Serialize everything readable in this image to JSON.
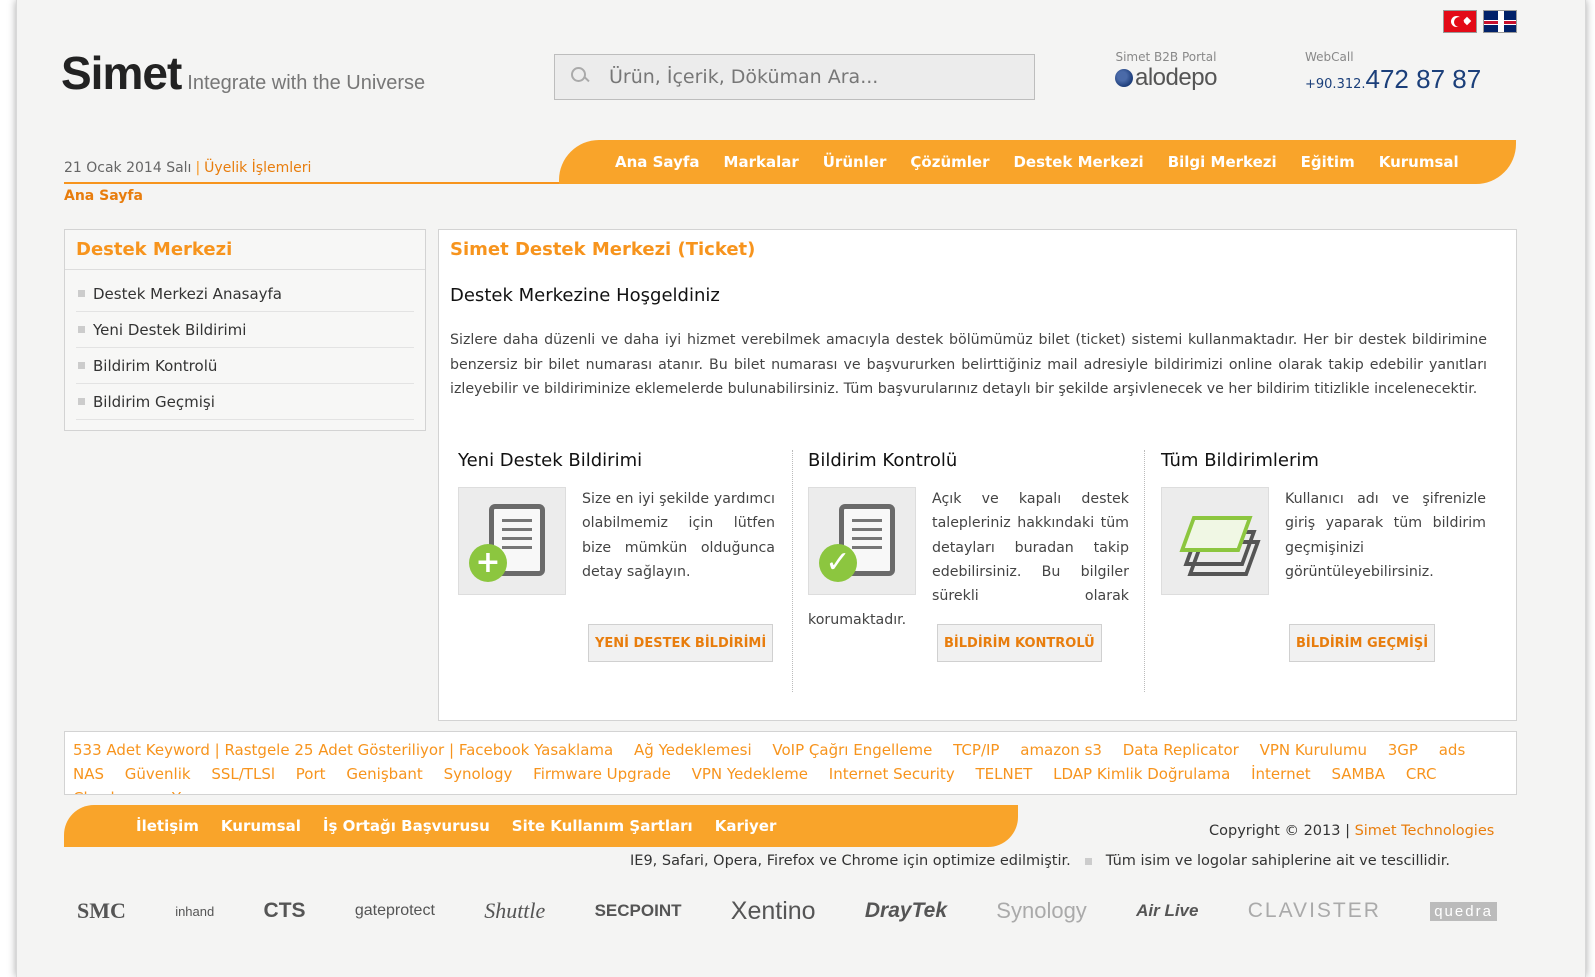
{
  "header": {
    "logo_text": "Simet",
    "tagline": "Integrate with the Universe",
    "search_placeholder": "Ürün, İçerik, Döküman Ara...",
    "portal_caption": "Simet B2B Portal",
    "portal_logo": "alodepo",
    "webcall_caption": "WebCall",
    "webcall_prefix": "+90.312.",
    "webcall_number": "472 87 87"
  },
  "meta": {
    "date": "21 Ocak 2014 Salı",
    "separator": "|",
    "membership_link": "Üyelik İşlemleri",
    "breadcrumb": "Ana Sayfa"
  },
  "nav": {
    "items": [
      "Ana Sayfa",
      "Markalar",
      "Ürünler",
      "Çözümler",
      "Destek Merkezi",
      "Bilgi Merkezi",
      "Eğitim",
      "Kurumsal"
    ]
  },
  "sidebar": {
    "title": "Destek Merkezi",
    "items": [
      "Destek Merkezi Anasayfa",
      "Yeni Destek Bildirimi",
      "Bildirim Kontrolü",
      "Bildirim Geçmişi"
    ]
  },
  "main": {
    "title": "Simet Destek Merkezi (Ticket)",
    "heading": "Destek Merkezine Hoşgeldiniz",
    "paragraph": "Sizlere daha düzenli ve daha iyi hizmet verebilmek amacıyla destek bölümümüz bilet (ticket) sistemi kullanmaktadır. Her bir destek bildirimine benzersiz bir bilet numarası atanır. Bu bilet numarası ve başvururken belirttiğiniz mail adresiyle bildirimizi online olarak takip edebilir yanıtları izleyebilir ve bildiriminize eklemelerde bulunabilirsiniz. Tüm başvurularınız detaylı bir şekilde arşivlenecek ve her bildirim titizlikle incelenecektir.",
    "columns": [
      {
        "heading": "Yeni Destek Bildirimi",
        "text": "Size en iyi şekilde yardımcı olabilmemiz için lütfen bize mümkün olduğunca detay sağlayın.",
        "button": "YENİ DESTEK BİLDİRİMİ",
        "icon": "new-ticket-icon",
        "badge": "+"
      },
      {
        "heading": "Bildirim Kontrolü",
        "text": "Açık ve kapalı destek talepleriniz hakkındaki tüm detayları buradan takip edebilirsiniz. Bu bilgiler sürekli olarak korumaktadır.",
        "button": "BİLDİRİM KONTROLÜ",
        "icon": "check-ticket-icon",
        "badge": "✓"
      },
      {
        "heading": "Tüm Bildirimlerim",
        "text": "Kullanıcı adı ve şifrenizle giriş yaparak tüm bildirim geçmişinizi görüntüleyebilirsiniz.",
        "button": "BİLDİRİM GEÇMİŞİ",
        "icon": "layers-icon"
      }
    ]
  },
  "tags": {
    "lead": "533 Adet Keyword | Rastgele 25 Adet Gösteriliyor |",
    "items": [
      "Facebook Yasaklama",
      "Ağ Yedeklemesi",
      "VoIP Çağrı Engelleme",
      "TCP/IP",
      "amazon s3",
      "Data Replicator",
      "VPN Kurulumu",
      "3GP",
      "ads",
      "NAS",
      "Güvenlik",
      "SSL/TLSl",
      "Port",
      "Genişbant",
      "Synology",
      "Firmware Upgrade",
      "VPN Yedekleme",
      "Internet Security",
      "TELNET",
      "LDAP Kimlik Doğrulama",
      "İnternet",
      "SAMBA",
      "CRC Checksum",
      "Yazıcı"
    ]
  },
  "footer": {
    "links": [
      "İletişim",
      "Kurumsal",
      "İş Ortağı Başvurusu",
      "Site Kullanım Şartları",
      "Kariyer"
    ],
    "copyright": "Copyright © 2013 |",
    "company": "Simet Technologies",
    "optimized": "IE9, Safari, Opera, Firefox ve Chrome için optimize edilmiştir.",
    "rights": "Tüm isim ve logolar sahiplerine ait ve tescillidir."
  },
  "brands": [
    "SMC",
    "inhand",
    "CTS",
    "gateprotect",
    "Shuttle",
    "SECPOINT",
    "Xentino",
    "DrayTek",
    "Synology",
    "Air Live",
    "CLAVISTER",
    "quedra"
  ],
  "colors": {
    "accent": "#f7941d",
    "nav_bg": "#f9a42a",
    "success": "#8cc63f",
    "phone": "#1b3f7a"
  }
}
